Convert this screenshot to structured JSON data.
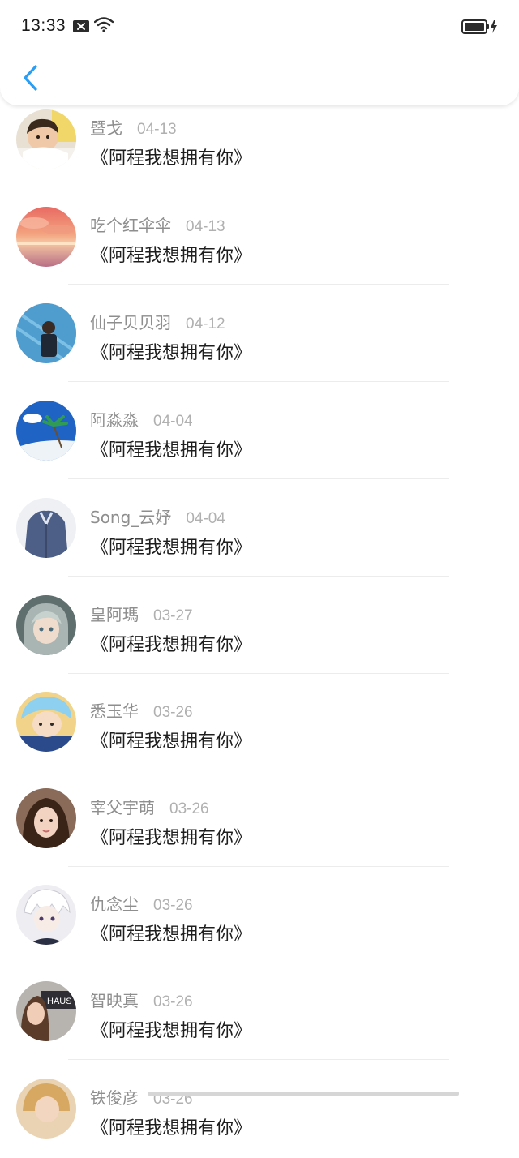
{
  "status_bar": {
    "time": "13:33",
    "notification_icon": "message-x-icon",
    "wifi_icon": "wifi-icon",
    "battery_icon": "battery-charging-icon"
  },
  "nav": {
    "back_icon": "chevron-left-icon",
    "accent_color": "#2a9df4"
  },
  "items": [
    {
      "name": "暨戈",
      "date": "04-13",
      "title": "《阿程我想拥有你》",
      "avatar": "avatar-child-photo"
    },
    {
      "name": "吃个红伞伞",
      "date": "04-13",
      "title": "《阿程我想拥有你》",
      "avatar": "avatar-sunset-clouds"
    },
    {
      "name": "仙子贝贝羽",
      "date": "04-12",
      "title": "《阿程我想拥有你》",
      "avatar": "avatar-man-blue-wall"
    },
    {
      "name": "阿淼淼",
      "date": "04-04",
      "title": "《阿程我想拥有你》",
      "avatar": "avatar-beach-sky"
    },
    {
      "name": "Song_云妤",
      "date": "04-04",
      "title": "《阿程我想拥有你》",
      "avatar": "avatar-denim-jacket"
    },
    {
      "name": "皇阿瑪",
      "date": "03-27",
      "title": "《阿程我想拥有你》",
      "avatar": "avatar-anime-girl-teal"
    },
    {
      "name": "悉玉华",
      "date": "03-26",
      "title": "《阿程我想拥有你》",
      "avatar": "avatar-anime-silver-hair"
    },
    {
      "name": "宰父宇萌",
      "date": "03-26",
      "title": "《阿程我想拥有你》",
      "avatar": "avatar-girl-selfie"
    },
    {
      "name": "仇念尘",
      "date": "03-26",
      "title": "《阿程我想拥有你》",
      "avatar": "avatar-anime-boy-white-hair"
    },
    {
      "name": "智映真",
      "date": "03-26",
      "title": "《阿程我想拥有你》",
      "avatar": "avatar-woman-haus-sign"
    },
    {
      "name": "铁俊彦",
      "date": "03-26",
      "title": "《阿程我想拥有你》",
      "avatar": "avatar-blonde-girl"
    }
  ]
}
